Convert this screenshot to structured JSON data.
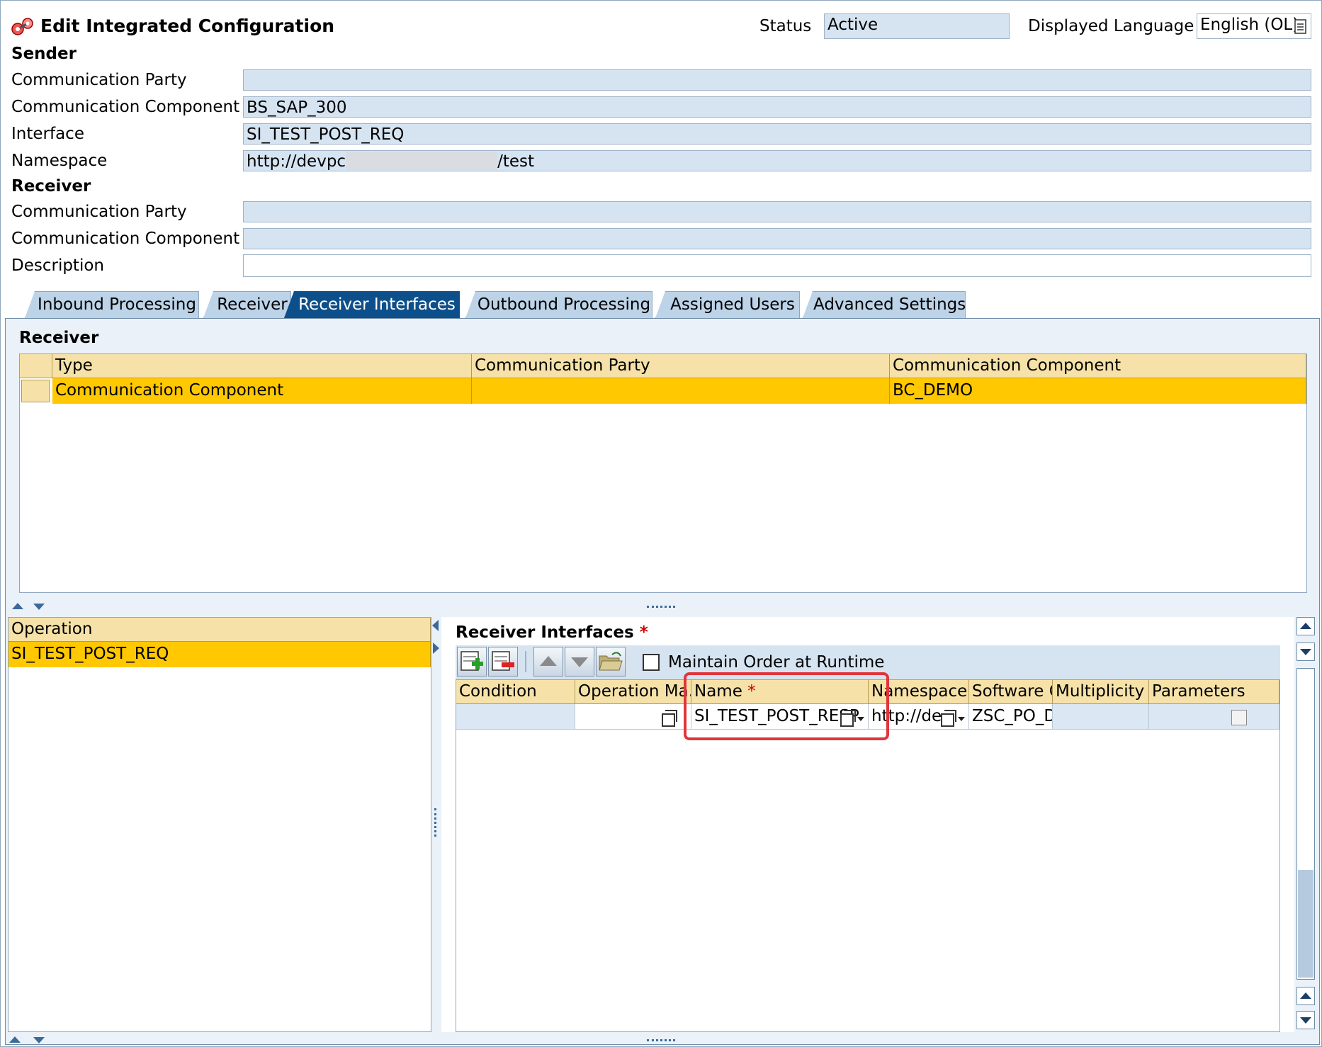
{
  "header": {
    "title": "Edit Integrated Configuration",
    "status_label": "Status",
    "status_value": "Active",
    "language_label": "Displayed Language",
    "language_value": "English (OL)"
  },
  "sender": {
    "section": "Sender",
    "party_label": "Communication Party",
    "party_value": "",
    "component_label": "Communication Component",
    "component_value": "BS_SAP_300",
    "interface_label": "Interface",
    "interface_value": "SI_TEST_POST_REQ",
    "namespace_label": "Namespace",
    "namespace_prefix": "http://devpc",
    "namespace_suffix": "/test"
  },
  "receiver": {
    "section": "Receiver",
    "party_label": "Communication Party",
    "party_value": "",
    "component_label": "Communication Component",
    "component_value": "",
    "description_label": "Description",
    "description_value": ""
  },
  "tabs": [
    {
      "label": "Inbound Processing"
    },
    {
      "label": "Receiver"
    },
    {
      "label": "Receiver Interfaces"
    },
    {
      "label": "Outbound Processing"
    },
    {
      "label": "Assigned Users"
    },
    {
      "label": "Advanced Settings"
    }
  ],
  "receiver_table": {
    "title": "Receiver",
    "columns": [
      "Type",
      "Communication Party",
      "Communication Component"
    ],
    "rows": [
      {
        "type": "Communication Component",
        "party": "",
        "component": "BC_DEMO"
      }
    ]
  },
  "operation_table": {
    "column": "Operation",
    "rows": [
      "SI_TEST_POST_REQ"
    ]
  },
  "receiver_interfaces": {
    "title": "Receiver Interfaces",
    "required_mark": "*",
    "maintain_order_label": "Maintain Order at Runtime",
    "columns": {
      "condition": "Condition",
      "operation_mapping": "Operation Ma...",
      "name": "Name",
      "namespace": "Namespace",
      "software_component": "Software C...",
      "multiplicity": "Multiplicity",
      "parameters": "Parameters"
    },
    "row": {
      "condition": "",
      "operation_mapping": "",
      "name": "SI_TEST_POST_RESP",
      "namespace": "http://de",
      "software_component": "ZSC_PO_D...",
      "multiplicity": ""
    }
  },
  "colors": {
    "field_bg": "#d6e4f2",
    "tab_active": "#0d4f8a",
    "header_cell": "#f6e2a8",
    "selected_row": "#ffc800",
    "highlight_box": "#e0353b"
  }
}
